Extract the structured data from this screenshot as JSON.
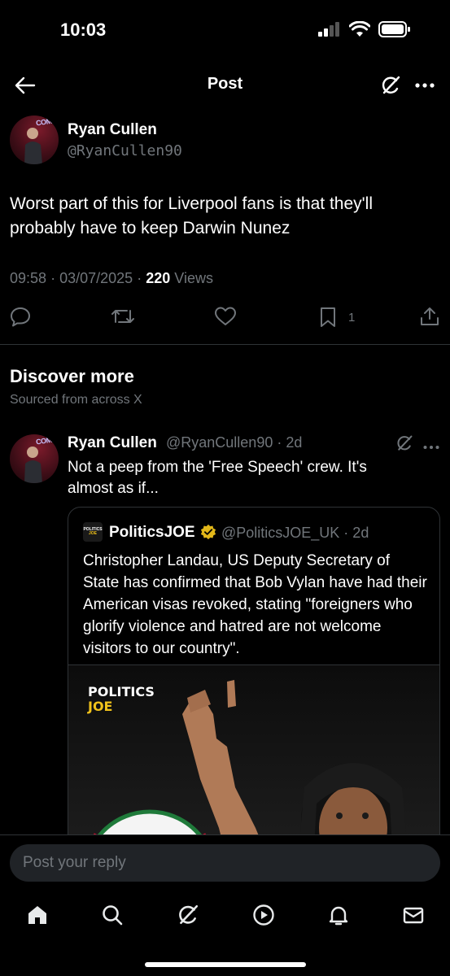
{
  "status_bar": {
    "time": "10:03"
  },
  "header": {
    "title": "Post"
  },
  "post": {
    "author_name": "Ryan Cullen",
    "author_handle": "@RyanCullen90",
    "avatar_sign": "COMEDY",
    "text": "Worst part of this for Liverpool fans is that they'll probably have to keep Darwin Nunez",
    "time": "09:58",
    "date": "03/07/2025",
    "separator": "·",
    "views_count": "220",
    "views_label": "Views",
    "bookmark_count": "1"
  },
  "discover": {
    "title": "Discover more",
    "subtitle": "Sourced from across X"
  },
  "tweet2": {
    "author_name": "Ryan Cullen",
    "handle_time": "@RyanCullen90 · 2d",
    "text": "Not a peep from the 'Free Speech' crew. It's almost as if...",
    "quote": {
      "logo_line1": "POLITICS",
      "logo_line2": "JOE",
      "author_name": "PoliticsJOE",
      "handle_time": "@PoliticsJOE_UK · 2d",
      "text": "Christopher Landau, US Deputy Secretary of State has confirmed that Bob Vylan have had their American visas revoked, stating \"foreigners who glorify violence and hatred are not welcome visitors to our country\".",
      "media_brand_line1": "POLITICS",
      "media_brand_line2": "JOE"
    }
  },
  "reply": {
    "placeholder": "Post your reply"
  },
  "colors": {
    "background": "#000000",
    "text": "#e7e9ea",
    "muted": "#71767b",
    "divider": "#2f3336",
    "verified_gold": "#e2b719",
    "brand_yellow": "#f0c21b"
  },
  "icons": {
    "header": [
      "back-arrow-icon",
      "grok-icon",
      "more-icon"
    ],
    "actions": [
      "reply-icon",
      "retweet-icon",
      "like-icon",
      "bookmark-icon",
      "share-icon"
    ],
    "tabs": [
      "home-icon",
      "search-icon",
      "grok-icon",
      "video-icon",
      "notifications-icon",
      "messages-icon"
    ]
  }
}
